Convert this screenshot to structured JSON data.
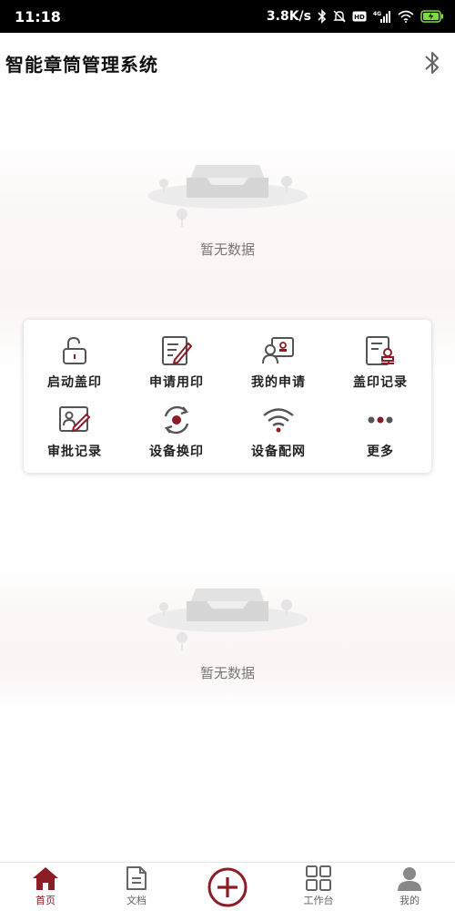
{
  "status_bar": {
    "time": "11:18",
    "speed": "3.8K/s",
    "icons": [
      "bluetooth-icon",
      "mute-icon",
      "hd-icon",
      "signal-icon",
      "wifi-icon",
      "battery-icon"
    ]
  },
  "header": {
    "title": "智能章筒管理系统",
    "action_icon": "bluetooth-icon"
  },
  "empty_top": {
    "text": "暂无数据"
  },
  "empty_bottom": {
    "text": "暂无数据"
  },
  "menu": {
    "items": [
      {
        "label": "启动盖印",
        "icon": "unlock-icon"
      },
      {
        "label": "申请用印",
        "icon": "edit-form-icon"
      },
      {
        "label": "我的申请",
        "icon": "my-application-icon"
      },
      {
        "label": "盖印记录",
        "icon": "stamp-record-icon"
      },
      {
        "label": "审批记录",
        "icon": "approval-record-icon"
      },
      {
        "label": "设备换印",
        "icon": "refresh-device-icon"
      },
      {
        "label": "设备配网",
        "icon": "wifi-icon"
      },
      {
        "label": "更多",
        "icon": "more-dots-icon"
      }
    ]
  },
  "tabs": [
    {
      "label": "首页",
      "icon": "home-icon",
      "active": true
    },
    {
      "label": "文档",
      "icon": "document-icon",
      "active": false
    },
    {
      "label": "",
      "icon": "add-circle-icon",
      "active": false
    },
    {
      "label": "工作台",
      "icon": "grid-icon",
      "active": false
    },
    {
      "label": "我的",
      "icon": "user-icon",
      "active": false
    }
  ],
  "colors": {
    "accent": "#8c1c26",
    "icon_gray": "#555555",
    "text_gray": "#777777"
  }
}
